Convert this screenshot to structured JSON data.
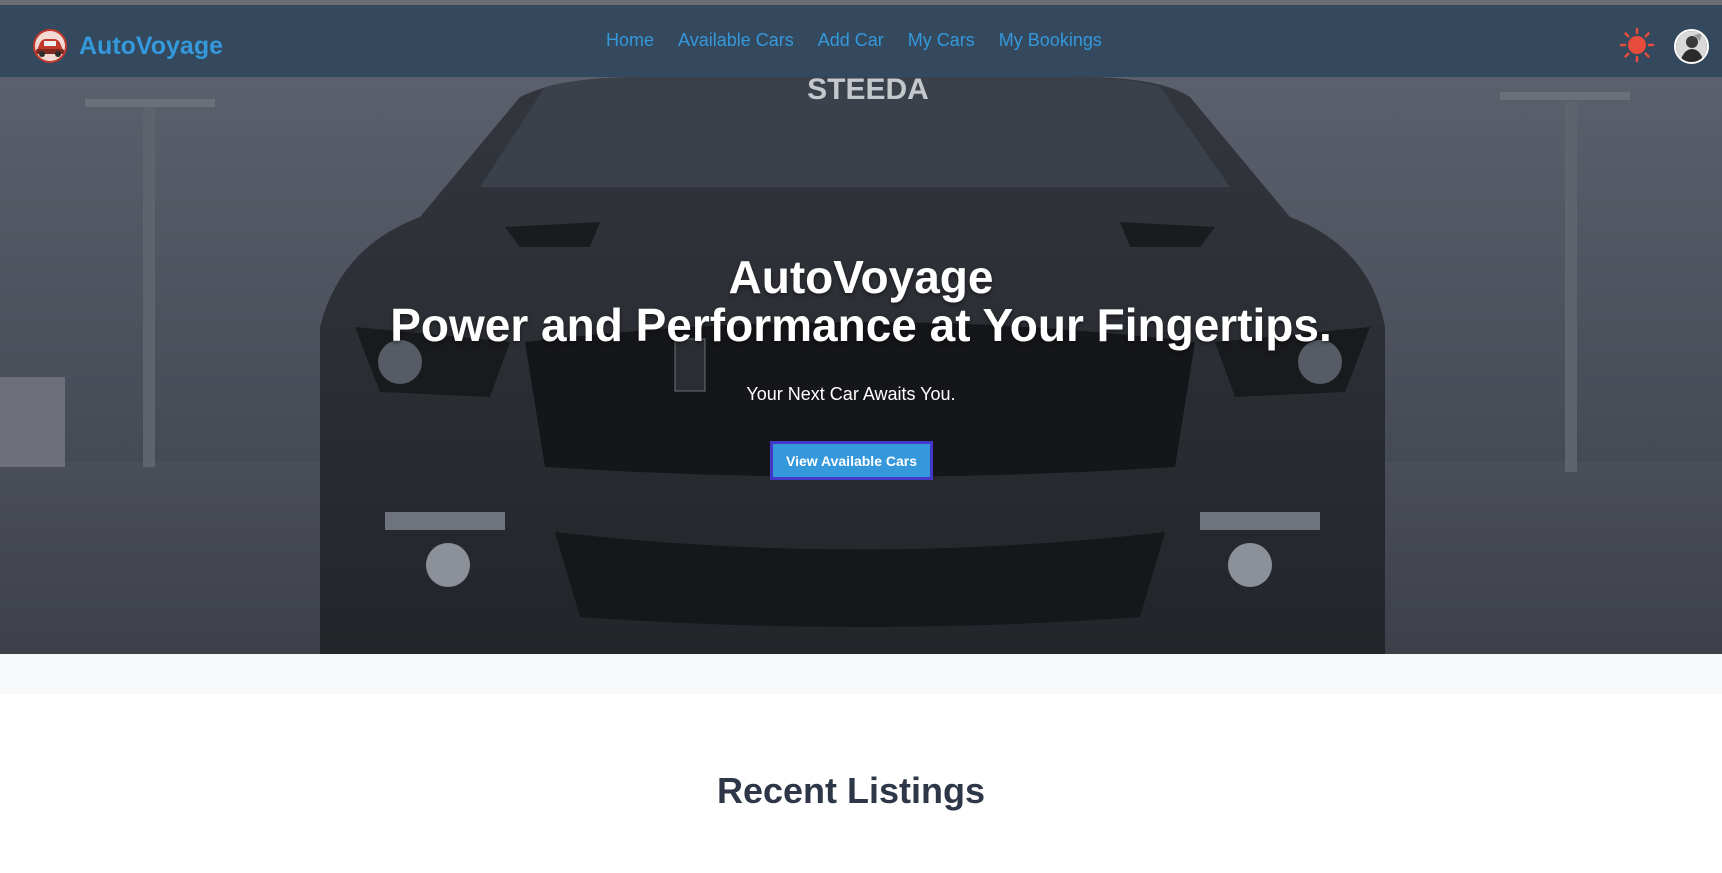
{
  "brand": {
    "name": "AutoVoyage"
  },
  "nav": {
    "items": [
      {
        "label": "Home"
      },
      {
        "label": "Available Cars"
      },
      {
        "label": "Add Car"
      },
      {
        "label": "My Cars"
      },
      {
        "label": "My Bookings"
      }
    ]
  },
  "header": {
    "theme_icon": "sun-icon",
    "avatar_icon": "user-avatar"
  },
  "hero": {
    "title": "AutoVoyage",
    "subtitle": "Power and Performance at Your Fingertips.",
    "tagline": "Your Next Car Awaits You.",
    "cta_label": "View Available Cars",
    "windshield_text": "STEEDA"
  },
  "listings": {
    "heading": "Recent Listings"
  },
  "colors": {
    "navbar_bg": "#34495e",
    "accent": "#3498db",
    "sun": "#e74c3c",
    "cta_border": "#4338ca"
  }
}
